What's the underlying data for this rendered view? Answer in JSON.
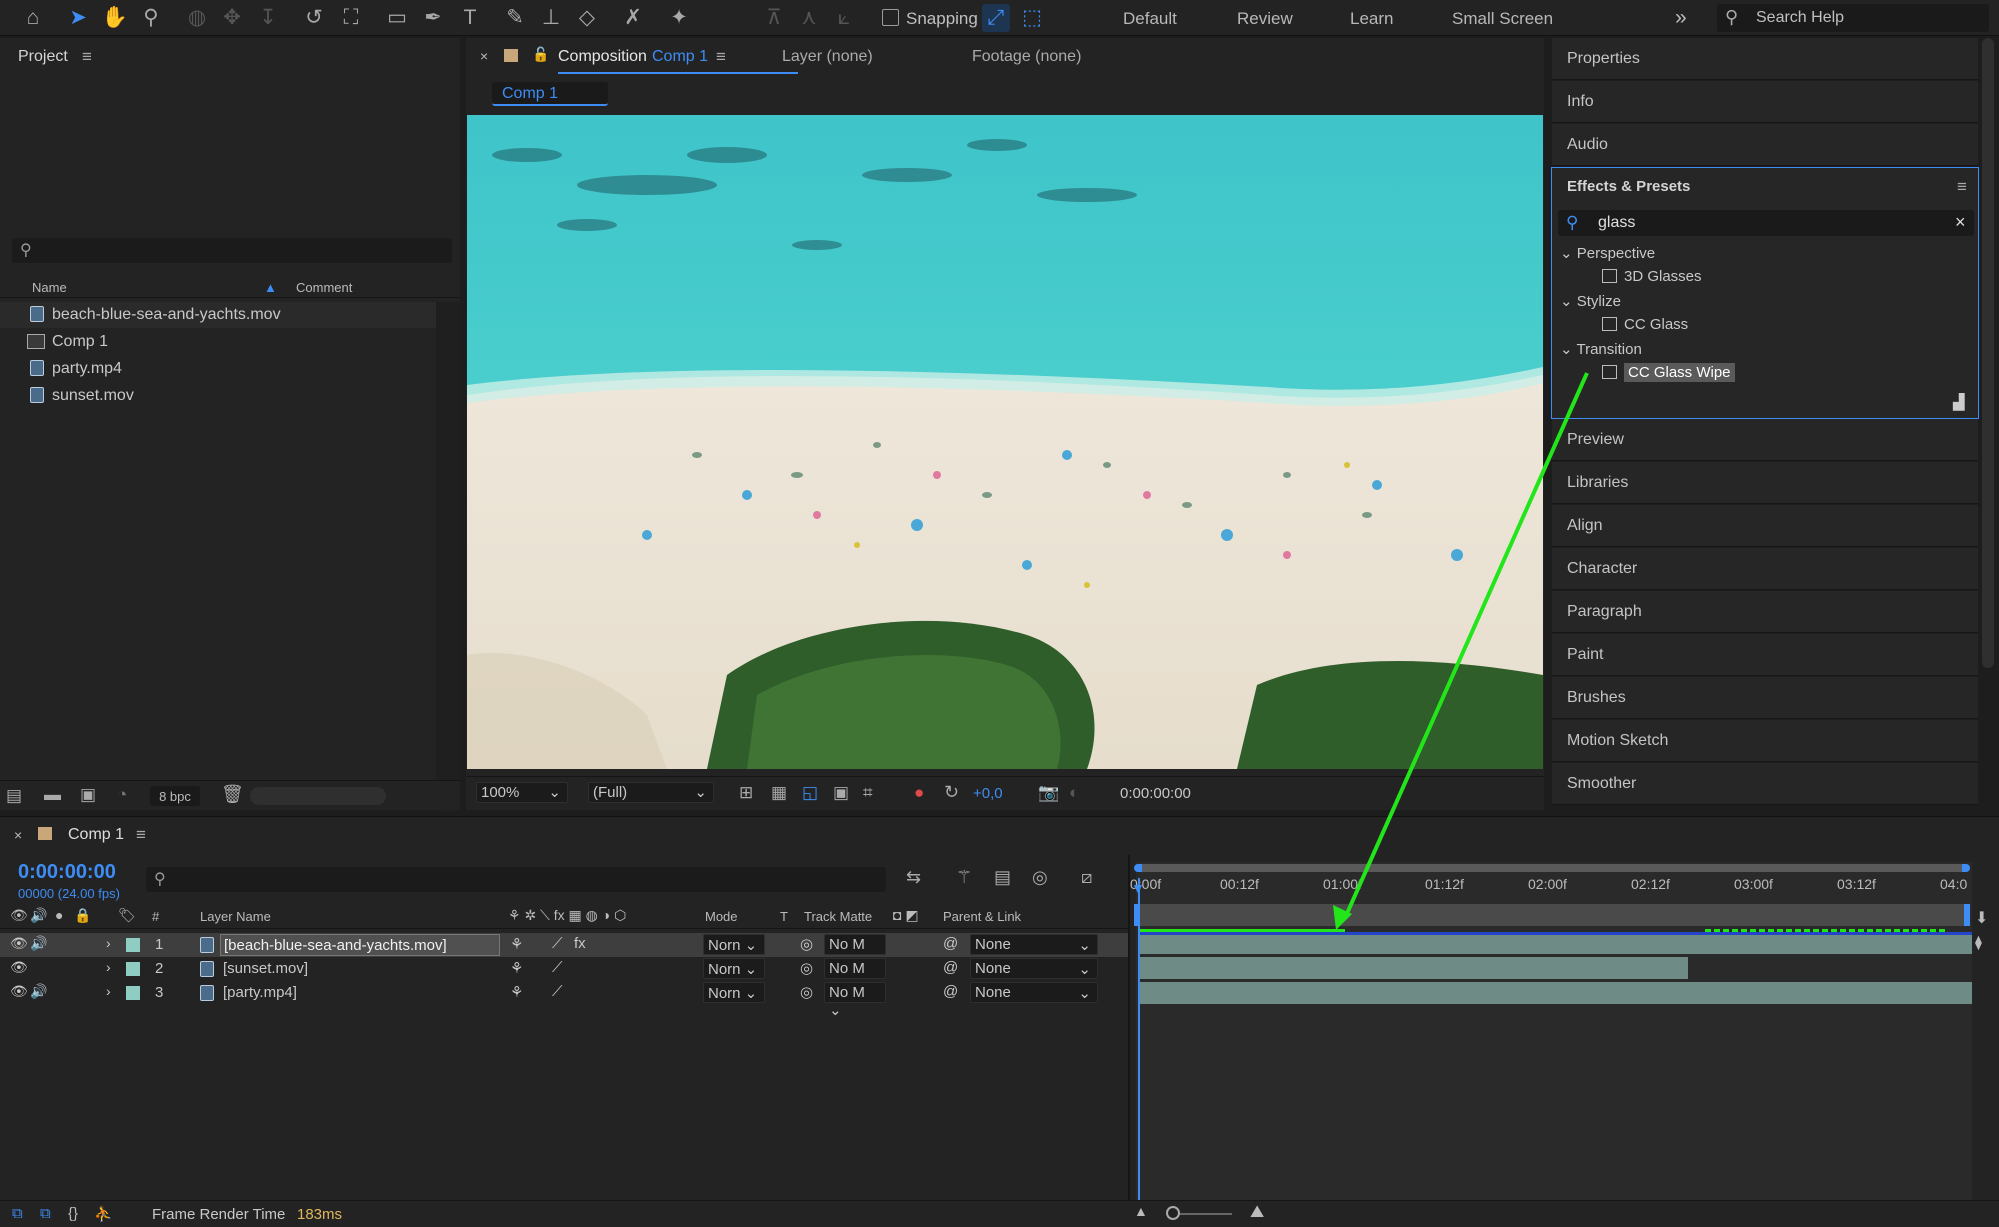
{
  "toolbar": {
    "snapping_label": "Snapping",
    "workspaces": [
      "Default",
      "Review",
      "Learn",
      "Small Screen"
    ],
    "search_help_placeholder": "Search Help"
  },
  "project": {
    "title": "Project",
    "search_value": "",
    "col_name": "Name",
    "col_comment": "Comment",
    "items": [
      {
        "name": "beach-blue-sea-and-yachts.mov",
        "type": "footage"
      },
      {
        "name": "Comp 1",
        "type": "composition"
      },
      {
        "name": "party.mp4",
        "type": "footage"
      },
      {
        "name": "sunset.mov",
        "type": "footage"
      }
    ],
    "bpc": "8 bpc"
  },
  "composition": {
    "tab_prefix": "Composition",
    "tab_name": "Comp 1",
    "layer_tab": "Layer (none)",
    "footage_tab": "Footage (none)",
    "breadcrumb": "Comp 1",
    "zoom": "100%",
    "resolution": "(Full)",
    "exposure": "+0,0",
    "timecode": "0:00:00:00"
  },
  "right_panels": {
    "top": [
      "Properties",
      "Info",
      "Audio"
    ],
    "effects_title": "Effects & Presets",
    "effects_search": "glass",
    "groups": [
      {
        "name": "Perspective",
        "items": [
          "3D Glasses"
        ]
      },
      {
        "name": "Stylize",
        "items": [
          "CC Glass"
        ]
      },
      {
        "name": "Transition",
        "items": [
          "CC Glass Wipe"
        ]
      }
    ],
    "bottom": [
      "Preview",
      "Libraries",
      "Align",
      "Character",
      "Paragraph",
      "Paint",
      "Brushes",
      "Motion Sketch",
      "Smoother"
    ]
  },
  "timeline": {
    "tab_name": "Comp 1",
    "timecode": "0:00:00:00",
    "fps": "00000 (24.00 fps)",
    "search_value": "",
    "col_hash": "#",
    "col_layer_name": "Layer Name",
    "col_mode": "Mode",
    "col_t": "T",
    "col_track_matte": "Track Matte",
    "col_parent": "Parent & Link",
    "ruler": [
      "0:00f",
      "00:12f",
      "01:00f",
      "01:12f",
      "02:00f",
      "02:12f",
      "03:00f",
      "03:12f",
      "04:0"
    ],
    "layers": [
      {
        "num": "1",
        "name": "[beach-blue-sea-and-yachts.mov]",
        "mode": "Norn",
        "matte": "No M",
        "parent": "None",
        "has_fx": true
      },
      {
        "num": "2",
        "name": "[sunset.mov]",
        "mode": "Norn",
        "matte": "No M",
        "parent": "None",
        "has_fx": false
      },
      {
        "num": "3",
        "name": "[party.mp4]",
        "mode": "Norn",
        "matte": "No M",
        "parent": "None",
        "has_fx": false
      }
    ],
    "footer_label": "Frame Render Time",
    "footer_value": "183ms"
  },
  "colors": {
    "accent_blue": "#3d8df5",
    "label_aqua": "#8fcdc3",
    "drag_arrow": "#22e61a",
    "render_time": "#e0b75a"
  }
}
